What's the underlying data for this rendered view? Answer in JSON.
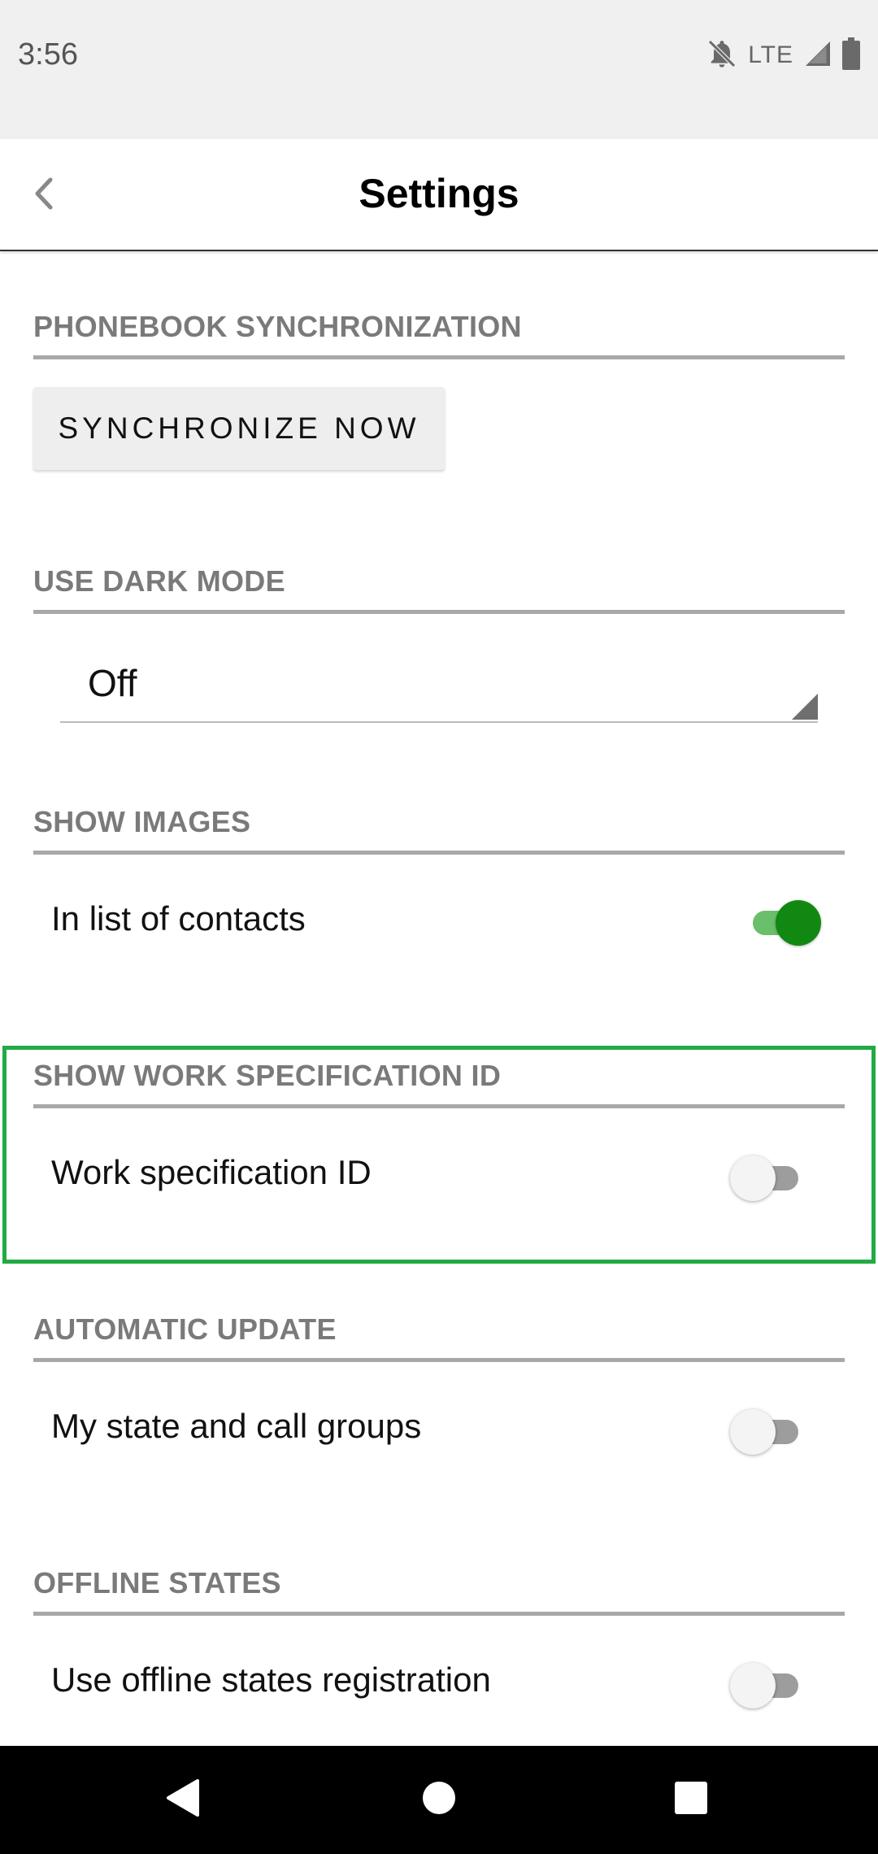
{
  "status_bar": {
    "time": "3:56",
    "network": "LTE"
  },
  "app_bar": {
    "title": "Settings"
  },
  "sections": {
    "phonebook": {
      "header": "PHONEBOOK SYNCHRONIZATION",
      "button_label": "SYNCHRONIZE NOW"
    },
    "dark_mode": {
      "header": "USE DARK MODE",
      "selected_value": "Off"
    },
    "show_images": {
      "header": "SHOW IMAGES",
      "label": "In list of contacts",
      "enabled": true
    },
    "work_spec": {
      "header": "SHOW WORK SPECIFICATION ID",
      "label": "Work specification ID",
      "enabled": false
    },
    "auto_update": {
      "header": "AUTOMATIC UPDATE",
      "label": "My state and call groups",
      "enabled": false
    },
    "offline": {
      "header": "OFFLINE STATES",
      "label": "Use offline states registration",
      "enabled": false
    }
  },
  "colors": {
    "accent_on": "#118811",
    "highlight": "#22aa44",
    "section_header": "#7a7a7a"
  },
  "icons": [
    "notifications-off-icon",
    "signal-icon",
    "battery-icon",
    "back-chevron-icon",
    "nav-back-icon",
    "nav-home-icon",
    "nav-recents-icon"
  ]
}
